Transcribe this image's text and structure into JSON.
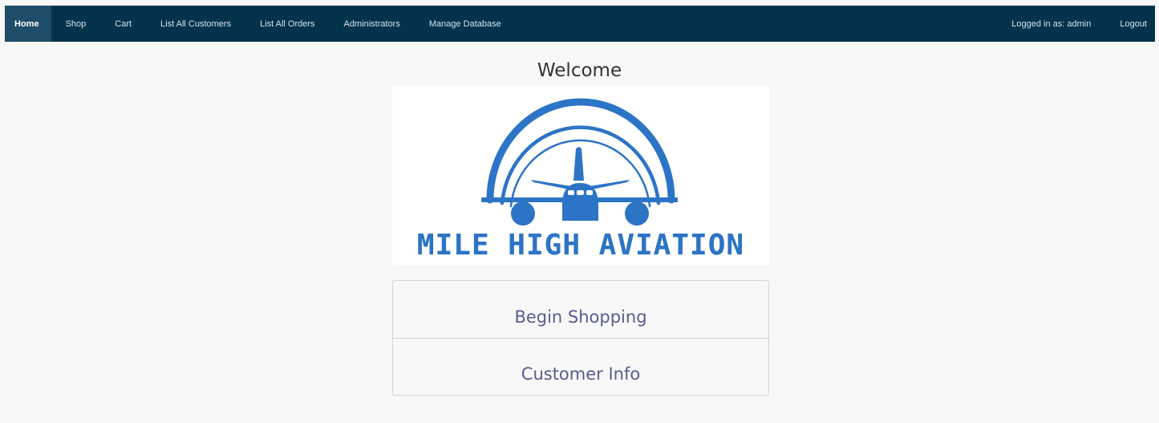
{
  "navbar": {
    "items": [
      {
        "label": "Home",
        "active": true
      },
      {
        "label": "Shop"
      },
      {
        "label": "Cart"
      },
      {
        "label": "List All Customers"
      },
      {
        "label": "List All Orders"
      },
      {
        "label": "Administrators"
      },
      {
        "label": "Manage Database"
      }
    ],
    "user_label": "Logged in as: admin",
    "logout_label": "Logout"
  },
  "main": {
    "title": "Welcome",
    "logo_text": "MILE HIGH AVIATION",
    "links": [
      {
        "label": "Begin Shopping"
      },
      {
        "label": "Customer Info"
      }
    ]
  },
  "colors": {
    "navbar_bg": "#03334c",
    "navbar_active_bg": "#1d4d68",
    "logo_blue": "#2c74c6",
    "link_text": "#5a5b8f"
  },
  "icons": {
    "logo": "airplane-icon"
  }
}
